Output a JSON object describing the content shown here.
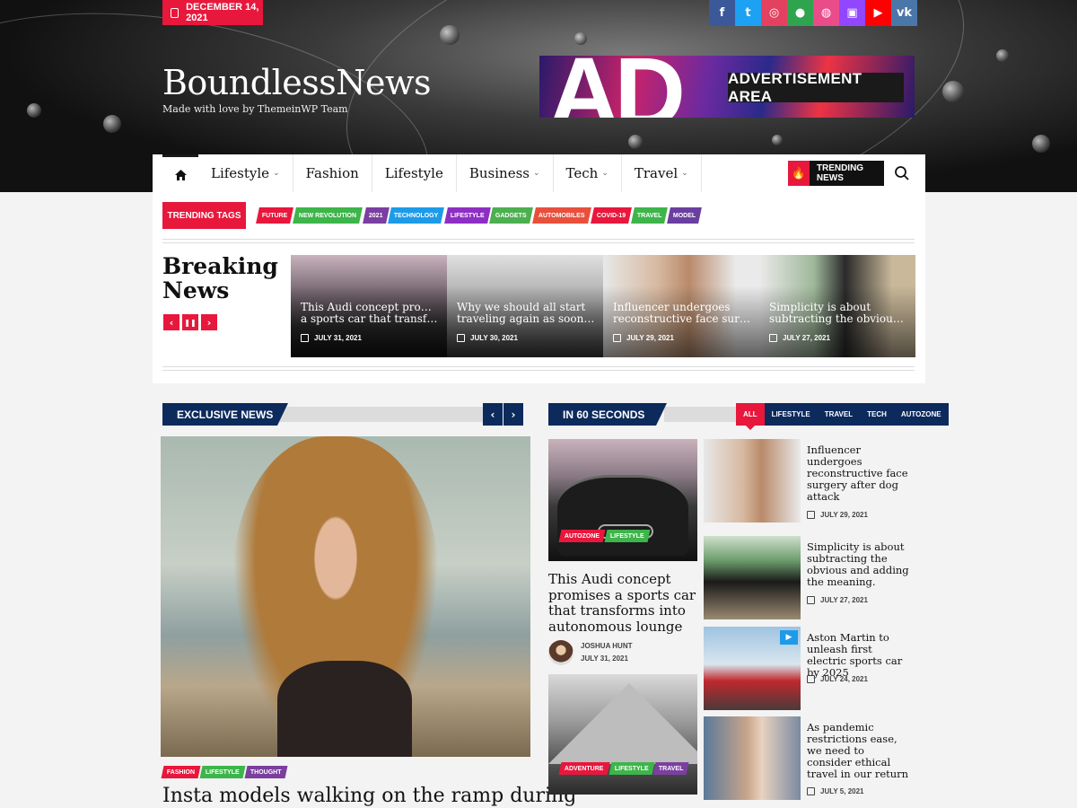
{
  "topbar": {
    "date": "DECEMBER 14, 2021"
  },
  "social": [
    {
      "icon": "facebook-icon",
      "glyph": "f",
      "color": "#3b5998"
    },
    {
      "icon": "twitter-icon",
      "glyph": "t",
      "color": "#1da1f2"
    },
    {
      "icon": "instagram-icon",
      "glyph": "◎",
      "color": "#e4405f"
    },
    {
      "icon": "github-icon",
      "glyph": "●",
      "color": "#2ea44f"
    },
    {
      "icon": "dribbble-icon",
      "glyph": "◍",
      "color": "#ea4c89"
    },
    {
      "icon": "twitch-icon",
      "glyph": "▣",
      "color": "#9146ff"
    },
    {
      "icon": "youtube-icon",
      "glyph": "▶",
      "color": "#ff0000"
    },
    {
      "icon": "vk-icon",
      "glyph": "vk",
      "color": "#4a76a8"
    }
  ],
  "site": {
    "title": "BoundlessNews",
    "tagline": "Made with love by ThemeinWP Team"
  },
  "ad": {
    "bigtext": "AD",
    "label": "ADVERTISEMENT AREA"
  },
  "nav": {
    "items": [
      {
        "label": "Lifestyle",
        "dropdown": true
      },
      {
        "label": "Fashion",
        "dropdown": false
      },
      {
        "label": "Lifestyle",
        "dropdown": false
      },
      {
        "label": "Business",
        "dropdown": true
      },
      {
        "label": "Tech",
        "dropdown": true
      },
      {
        "label": "Travel",
        "dropdown": true
      }
    ],
    "trending_label": "TRENDING NEWS"
  },
  "trending_tags": {
    "label": "TRENDING TAGS",
    "tags": [
      {
        "text": "FUTURE",
        "color": "#e8173c"
      },
      {
        "text": "NEW REVOLUTION",
        "color": "#3db54a"
      },
      {
        "text": "2021",
        "color": "#7b3fa0"
      },
      {
        "text": "TECHNOLOGY",
        "color": "#1e9be8"
      },
      {
        "text": "LIFESTYLE",
        "color": "#8e2fc4"
      },
      {
        "text": "GADGETS",
        "color": "#4caf50"
      },
      {
        "text": "AUTOMOBILES",
        "color": "#e8503c"
      },
      {
        "text": "COVID-19",
        "color": "#e8173c"
      },
      {
        "text": "TRAVEL",
        "color": "#3db54a"
      },
      {
        "text": "MODEL",
        "color": "#6a3fa0"
      }
    ]
  },
  "breaking": {
    "title_line1": "Breaking",
    "title_line2": "News",
    "slides": [
      {
        "line1": "This Audi concept promises",
        "line2": "a sports car that transform",
        "date": "JULY 31, 2021"
      },
      {
        "line1": "Why we should all start",
        "line2": "traveling again as soon as",
        "date": "JULY 30, 2021"
      },
      {
        "line1": "Influencer undergoes",
        "line2": "reconstructive face surger",
        "date": "JULY 29, 2021"
      },
      {
        "line1": "Simplicity is about",
        "line2": "subtracting the obvious an",
        "date": "JULY 27, 2021"
      }
    ]
  },
  "exclusive": {
    "heading": "EXCLUSIVE NEWS",
    "cats": [
      {
        "text": "FASHION",
        "color": "#e8173c"
      },
      {
        "text": "LIFESTYLE",
        "color": "#3db54a"
      },
      {
        "text": "THOUGHT",
        "color": "#7b3fa0"
      }
    ],
    "title": "Insta models walking on the ramp during"
  },
  "in60": {
    "heading": "IN 60 SECONDS",
    "filters": [
      "ALL",
      "LIFESTYLE",
      "TRAVEL",
      "TECH",
      "AUTOZONE"
    ],
    "main": {
      "cats": [
        {
          "text": "AUTOZONE",
          "color": "#e8173c"
        },
        {
          "text": "LIFESTYLE",
          "color": "#3db54a"
        }
      ],
      "title": "This Audi concept promises a sports car that transforms into autonomous lounge",
      "author": "JOSHUA HUNT",
      "date": "JULY 31, 2021"
    },
    "second_cats": [
      {
        "text": "ADVENTURE",
        "color": "#e8173c"
      },
      {
        "text": "LIFESTYLE",
        "color": "#3db54a"
      },
      {
        "text": "TRAVEL",
        "color": "#7b3fa0"
      }
    ],
    "side": [
      {
        "title": "Influencer undergoes reconstructive face surgery after dog attack",
        "date": "JULY 29, 2021"
      },
      {
        "title": "Simplicity is about subtracting the obvious and adding the meaning.",
        "date": "JULY 27, 2021"
      },
      {
        "title": "Aston Martin to unleash first electric sports car by 2025",
        "date": "JULY 24, 2021"
      },
      {
        "title": "As pandemic restrictions ease, we need to consider ethical travel in our return",
        "date": "JULY 5, 2021"
      }
    ]
  }
}
